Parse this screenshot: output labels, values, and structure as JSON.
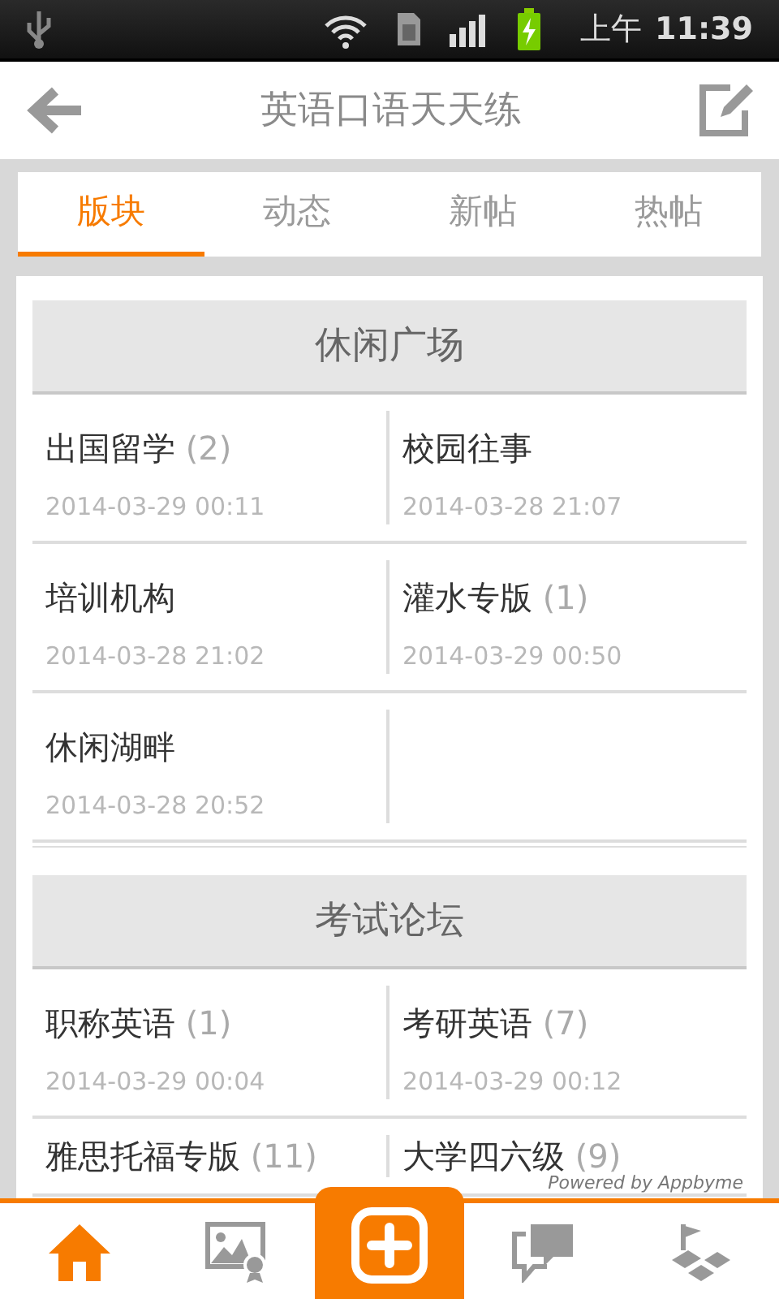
{
  "status_bar": {
    "meridiem": "上午",
    "time": "11:39"
  },
  "header": {
    "title": "英语口语天天练"
  },
  "tabs": [
    {
      "label": "版块",
      "selected": true
    },
    {
      "label": "动态",
      "selected": false
    },
    {
      "label": "新帖",
      "selected": false
    },
    {
      "label": "热帖",
      "selected": false
    }
  ],
  "sections": [
    {
      "title": "休闲广场",
      "boards": [
        {
          "name": "出国留学",
          "count": "(2)",
          "date": "2014-03-29 00:11"
        },
        {
          "name": "校园往事",
          "date": "2014-03-28 21:07"
        },
        {
          "name": "培训机构",
          "date": "2014-03-28 21:02"
        },
        {
          "name": "灌水专版",
          "count": "(1)",
          "date": "2014-03-29 00:50"
        },
        {
          "name": "休闲湖畔",
          "date": "2014-03-28 20:52"
        }
      ]
    },
    {
      "title": "考试论坛",
      "boards": [
        {
          "name": "职称英语",
          "count": "(1)",
          "date": "2014-03-29 00:04"
        },
        {
          "name": "考研英语",
          "count": "(7)",
          "date": "2014-03-29 00:12"
        },
        {
          "name": "雅思托福专版",
          "count": "(11)"
        },
        {
          "name": "大学四六级",
          "count": "(9)"
        }
      ]
    }
  ],
  "credit": "Powered by Appbyme",
  "bottom_nav": [
    {
      "kind": "home",
      "selected": true
    },
    {
      "kind": "gallery",
      "selected": false
    },
    {
      "kind": "compose"
    },
    {
      "kind": "messages",
      "selected": false
    },
    {
      "kind": "map",
      "selected": false
    }
  ]
}
